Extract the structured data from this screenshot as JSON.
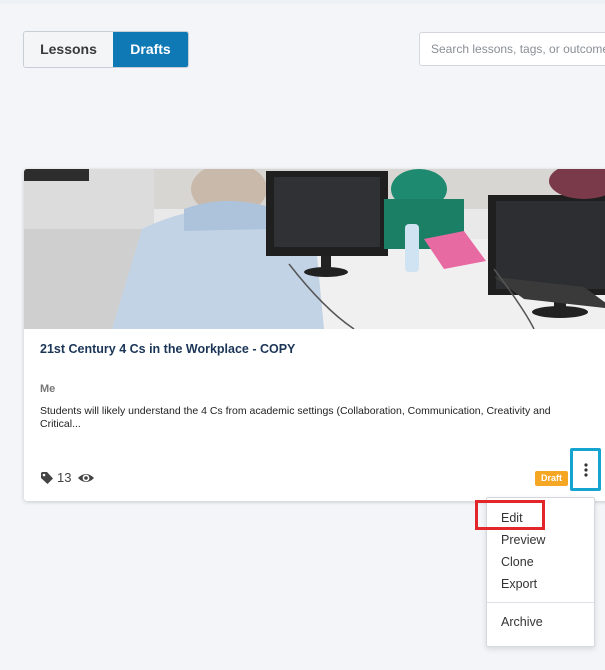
{
  "toggle": {
    "lessons_label": "Lessons",
    "drafts_label": "Drafts",
    "active": "Drafts"
  },
  "search": {
    "placeholder": "Search lessons, tags, or outcomes",
    "value": ""
  },
  "card": {
    "title": "21st Century 4 Cs in the Workplace - COPY",
    "author": "Me",
    "description": "Students will likely understand the 4 Cs from academic settings (Collaboration, Communication, Creativity and Critical...",
    "tag_count": "13",
    "status_badge": "Draft",
    "icons": {
      "tag": "tag-icon",
      "views": "eye-icon",
      "more": "kebab-menu-icon"
    }
  },
  "menu": {
    "items": [
      {
        "label": "Edit",
        "highlighted": true
      },
      {
        "label": "Preview"
      },
      {
        "label": "Clone"
      },
      {
        "label": "Export"
      },
      {
        "label": "Archive"
      }
    ]
  },
  "colors": {
    "accent_blue": "#0f79b5",
    "highlight_cyan": "#14a4cf",
    "highlight_red": "#e2262a",
    "draft_badge": "#f5a623",
    "title_navy": "#1b3557"
  }
}
